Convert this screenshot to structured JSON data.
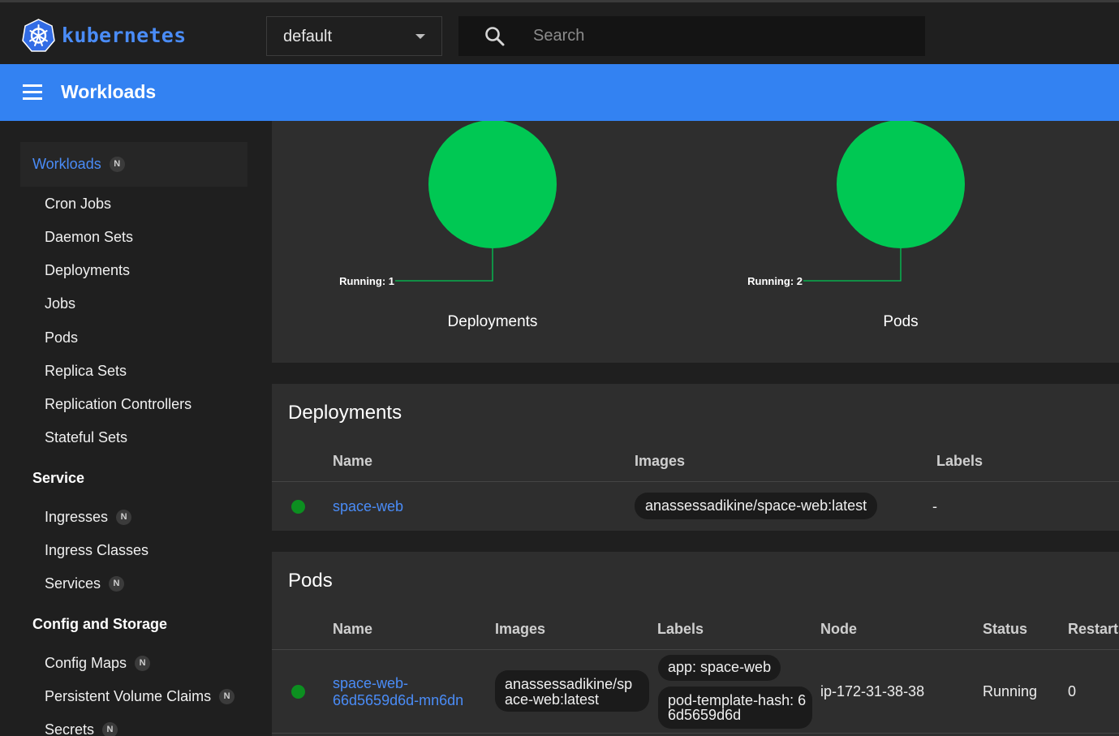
{
  "app": {
    "name": "kubernetes"
  },
  "namespace": {
    "selected": "default"
  },
  "search": {
    "placeholder": "Search"
  },
  "header": {
    "title": "Workloads"
  },
  "sidebar": {
    "workloads": {
      "label": "Workloads",
      "badge": "N"
    },
    "workload_items": [
      "Cron Jobs",
      "Daemon Sets",
      "Deployments",
      "Jobs",
      "Pods",
      "Replica Sets",
      "Replication Controllers",
      "Stateful Sets"
    ],
    "service": {
      "heading": "Service",
      "items": [
        {
          "label": "Ingresses",
          "badge": "N"
        },
        {
          "label": "Ingress Classes",
          "badge": ""
        },
        {
          "label": "Services",
          "badge": "N"
        }
      ]
    },
    "config": {
      "heading": "Config and Storage",
      "items": [
        {
          "label": "Config Maps",
          "badge": "N"
        },
        {
          "label": "Persistent Volume Claims",
          "badge": "N"
        },
        {
          "label": "Secrets",
          "badge": "N"
        }
      ]
    }
  },
  "status_charts": [
    {
      "title": "Deployments",
      "running_label": "Running: 1",
      "running": 1
    },
    {
      "title": "Pods",
      "running_label": "Running: 2",
      "running": 2
    }
  ],
  "colors": {
    "running": "#00c853",
    "status_dot": "#0c8f20",
    "accent": "#3382f2",
    "link": "#4a8cf7"
  },
  "deployments": {
    "title": "Deployments",
    "columns": [
      "Name",
      "Images",
      "Labels"
    ],
    "rows": [
      {
        "name": "space-web",
        "image": "anassessadikine/space-web:latest",
        "labels": "-"
      }
    ]
  },
  "pods": {
    "title": "Pods",
    "columns": [
      "Name",
      "Images",
      "Labels",
      "Node",
      "Status",
      "Restarts"
    ],
    "rows": [
      {
        "name_line1": "space-web-",
        "name_line2": "66d5659d6d-mn6dn",
        "image_line1": "anassessadikine/sp",
        "image_line2": "ace-web:latest",
        "label1": "app: space-web",
        "label2_line1": "pod-template-hash: 6",
        "label2_line2": "6d5659d6d",
        "node": "ip-172-31-38-38",
        "status": "Running",
        "restarts": "0"
      }
    ]
  }
}
